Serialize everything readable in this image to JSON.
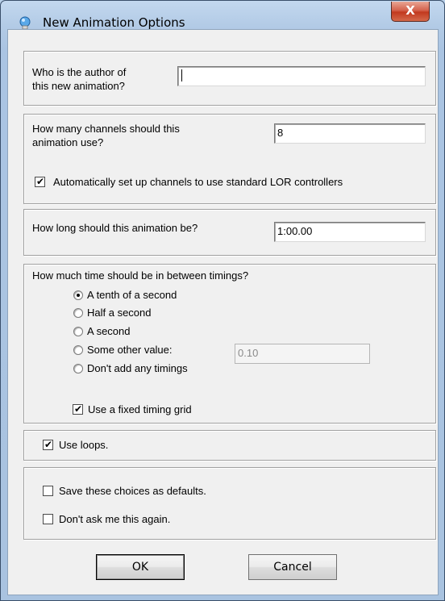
{
  "window": {
    "title": "New Animation Options",
    "close_glyph": "X"
  },
  "author": {
    "label_line1": "Who is the author of",
    "label_line2": "this new animation?",
    "value": ""
  },
  "channels": {
    "label_line1": "How many channels should this",
    "label_line2": "animation use?",
    "value": "8",
    "auto_setup_label": "Automatically set up channels to use standard LOR controllers",
    "auto_setup_checked": true
  },
  "length": {
    "label": "How long should this animation be?",
    "value": "1:00.00"
  },
  "timings": {
    "label": "How much time should be in between timings?",
    "options": [
      {
        "label": "A tenth of a second",
        "selected": true
      },
      {
        "label": "Half a second",
        "selected": false
      },
      {
        "label": "A second",
        "selected": false
      },
      {
        "label": "Some other value:",
        "selected": false
      },
      {
        "label": "Don't add any timings",
        "selected": false
      }
    ],
    "other_value": "0.10",
    "fixed_grid_label": "Use a fixed timing grid",
    "fixed_grid_checked": true
  },
  "loops": {
    "label": "Use loops.",
    "checked": true
  },
  "prefs": {
    "save_defaults_label": "Save these choices as defaults.",
    "save_defaults_checked": false,
    "dont_ask_label": "Don't ask me this again.",
    "dont_ask_checked": false
  },
  "buttons": {
    "ok": "OK",
    "cancel": "Cancel"
  },
  "icons": {
    "title_icon": "lightbulb-icon",
    "check_glyph": "✔"
  }
}
